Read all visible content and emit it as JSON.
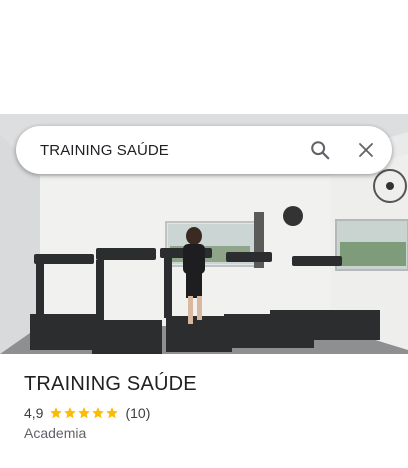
{
  "search": {
    "query": "TRAINING SAÚDE",
    "search_icon": "search-icon",
    "close_icon": "close-icon"
  },
  "place": {
    "name": "TRAINING SAÚDE",
    "rating": "4,9",
    "stars": 5,
    "review_count": "(10)",
    "category": "Academia"
  },
  "colors": {
    "star": "#fbbc04",
    "text_primary": "#202124",
    "text_secondary": "#5f6368"
  }
}
